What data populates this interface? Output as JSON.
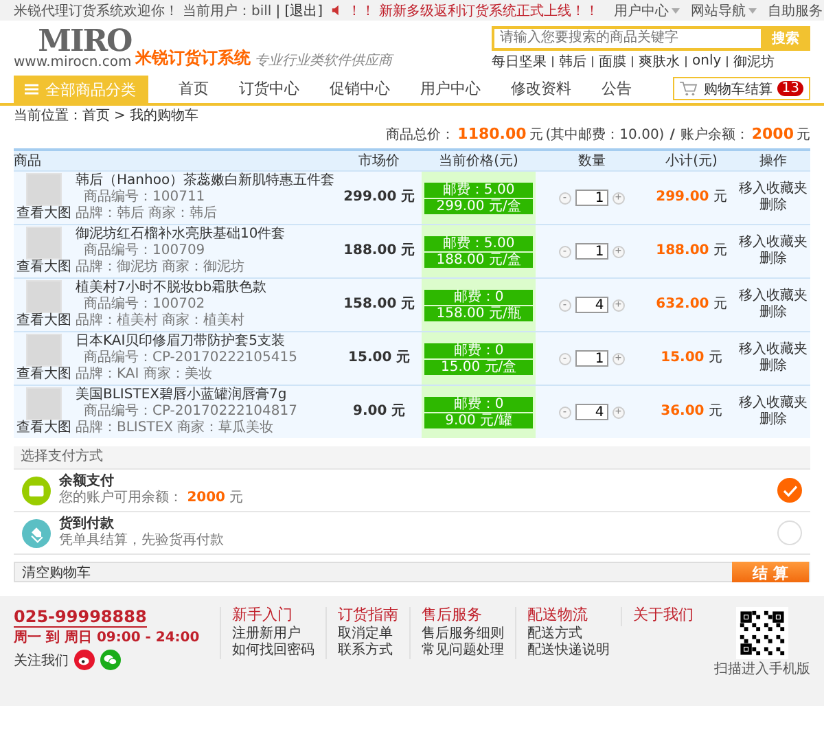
{
  "top_bar": {
    "welcome": "米锐代理订货系统欢迎你！",
    "user_label": "当前用户：bill",
    "logout": "| [退出]",
    "alert_marks": "！！",
    "announcement": "新新多级返利订货系统正式上线！！",
    "menus": [
      "用户中心",
      "网站导航",
      "自助服务"
    ]
  },
  "header": {
    "logo_text": "MIRO",
    "logo_url": "www.mirocn.com",
    "brand": "米锐订货订系统",
    "slogan": "专业行业类软件供应商",
    "search": {
      "placeholder": "请输入您要搜索的商品关键字",
      "button": "搜索"
    },
    "hot_keywords": [
      "每日坚果",
      "韩后",
      "面膜",
      "爽肤水",
      "only",
      "御泥坊"
    ]
  },
  "nav": {
    "category_button": "全部商品分类",
    "items": [
      {
        "label": "首页",
        "selected": false
      },
      {
        "label": "订货中心",
        "selected": false
      },
      {
        "label": "促销中心",
        "selected": false
      },
      {
        "label": "用户中心",
        "selected": false
      },
      {
        "label": "修改资料",
        "selected": false
      },
      {
        "label": "公告",
        "selected": false
      }
    ],
    "cart": {
      "label": "购物车结算",
      "count": "13"
    }
  },
  "breadcrumb": [
    "当前位置：首页",
    ">",
    "我的购物车"
  ],
  "summary": {
    "total_label": "商品总价：",
    "total": "1180.00",
    "total_unit": "元",
    "postage_note": "(其中邮费：10.00)",
    "separator": "/",
    "balance_label": "账户余额：",
    "balance": "2000",
    "balance_unit": "元"
  },
  "table": {
    "columns": [
      "商品",
      "市场价",
      "当前价格(元)",
      "数量",
      "小计(元)",
      "操作"
    ],
    "rows": [
      {
        "name": "韩后（Hanhoo）茶蕊嫩白新肌特惠五件套",
        "code": "商品编号：100711",
        "brand": "品牌：韩后 商家：韩后",
        "view": "查看大图",
        "market_price": "299.00 元",
        "postage": "邮费：5.00",
        "unit_price": "299.00 元/盒",
        "minus": "-",
        "qty": "1",
        "plus": "+",
        "subtotal": "299.00",
        "subtotal_unit": "元",
        "actions": [
          "移入收藏夹",
          "删除"
        ]
      },
      {
        "name": "御泥坊红石榴补水亮肤基础10件套",
        "code": "商品编号：100709",
        "brand": "品牌：御泥坊 商家：御泥坊",
        "view": "查看大图",
        "market_price": "188.00 元",
        "postage": "邮费：5.00",
        "unit_price": "188.00 元/盒",
        "minus": "-",
        "qty": "1",
        "plus": "+",
        "subtotal": "188.00",
        "subtotal_unit": "元",
        "actions": [
          "移入收藏夹",
          "删除"
        ]
      },
      {
        "name": "植美村7小时不脱妆bb霜肤色款",
        "code": "商品编号：100702",
        "brand": "品牌：植美村 商家：植美村",
        "view": "查看大图",
        "market_price": "158.00 元",
        "postage": "邮费：0",
        "unit_price": "158.00 元/瓶",
        "minus": "-",
        "qty": "4",
        "plus": "+",
        "subtotal": "632.00",
        "subtotal_unit": "元",
        "actions": [
          "移入收藏夹",
          "删除"
        ]
      },
      {
        "name": "日本KAI贝印修眉刀带防护套5支装",
        "code": "商品编号：CP-20170222105415",
        "brand": "品牌：KAI 商家：美妆",
        "view": "查看大图",
        "market_price": "15.00 元",
        "postage": "邮费：0",
        "unit_price": "15.00 元/盒",
        "minus": "-",
        "qty": "1",
        "plus": "+",
        "subtotal": "15.00",
        "subtotal_unit": "元",
        "actions": [
          "移入收藏夹",
          "删除"
        ]
      },
      {
        "name": "美国BLISTEX碧唇小蓝罐润唇膏7g",
        "code": "商品编号：CP-20170222104817",
        "brand": "品牌：BLISTEX 商家：草瓜美妆",
        "view": "查看大图",
        "market_price": "9.00 元",
        "postage": "邮费：0",
        "unit_price": "9.00 元/罐",
        "minus": "-",
        "qty": "4",
        "plus": "+",
        "subtotal": "36.00",
        "subtotal_unit": "元",
        "actions": [
          "移入收藏夹",
          "删除"
        ]
      }
    ]
  },
  "payment": {
    "title": "选择支付方式",
    "methods": [
      {
        "kind": "wallet",
        "name": "余额支付",
        "desc": "您的账户可用余额：",
        "amount": "2000",
        "unit": "元",
        "selected": true
      },
      {
        "kind": "tag",
        "name": "货到付款",
        "desc": "凭单具结算，先验货再付款",
        "selected": false
      }
    ]
  },
  "actions": {
    "clear": "清空购物车",
    "checkout": "结 算"
  },
  "footer": {
    "phone": "025-99998888",
    "hours": "周一 到 周日  09:00 - 24:00",
    "follow": "关注我们",
    "columns": [
      {
        "title": "新手入门",
        "links": [
          "注册新用户",
          "如何找回密码"
        ]
      },
      {
        "title": "订货指南",
        "links": [
          "取消定单",
          "联系方式"
        ]
      },
      {
        "title": "售后服务",
        "links": [
          "售后服务细则",
          "常见问题处理"
        ]
      },
      {
        "title": "配送物流",
        "links": [
          "配送方式",
          "配送快递说明"
        ]
      },
      {
        "title": "关于我们"
      }
    ],
    "qr_caption": "扫描进入手机版"
  }
}
